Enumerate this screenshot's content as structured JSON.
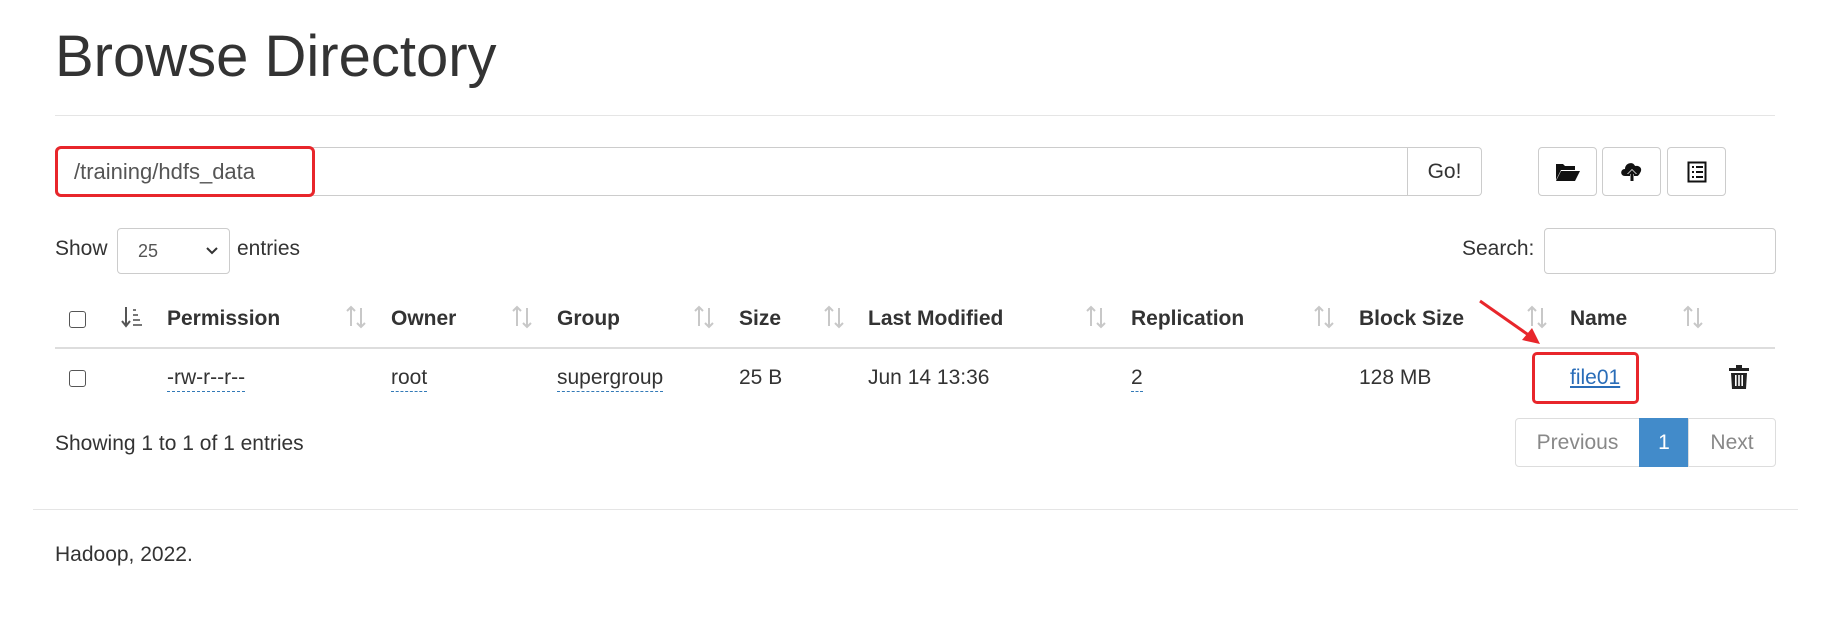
{
  "page": {
    "title": "Browse Directory",
    "footer": "Hadoop, 2022."
  },
  "toolbar": {
    "path_value": "/training/hdfs_data",
    "go_label": "Go!",
    "icons": [
      "folder-open-icon",
      "cloud-upload-icon",
      "list-icon"
    ]
  },
  "controls": {
    "show_label": "Show",
    "entries_value": "25",
    "entries_label": "entries",
    "search_label": "Search:",
    "search_value": ""
  },
  "table": {
    "columns": [
      "Permission",
      "Owner",
      "Group",
      "Size",
      "Last Modified",
      "Replication",
      "Block Size",
      "Name"
    ],
    "rows": [
      {
        "permission": "-rw-r--r--",
        "owner": "root",
        "group": "supergroup",
        "size": "25 B",
        "last_modified": "Jun 14 13:36",
        "replication": "2",
        "block_size": "128 MB",
        "name": "file01"
      }
    ]
  },
  "pagination": {
    "info": "Showing 1 to 1 of 1 entries",
    "previous": "Previous",
    "current": "1",
    "next": "Next"
  },
  "colors": {
    "accent": "#428bca",
    "link": "#2a6db8",
    "highlight": "#e8262b"
  }
}
